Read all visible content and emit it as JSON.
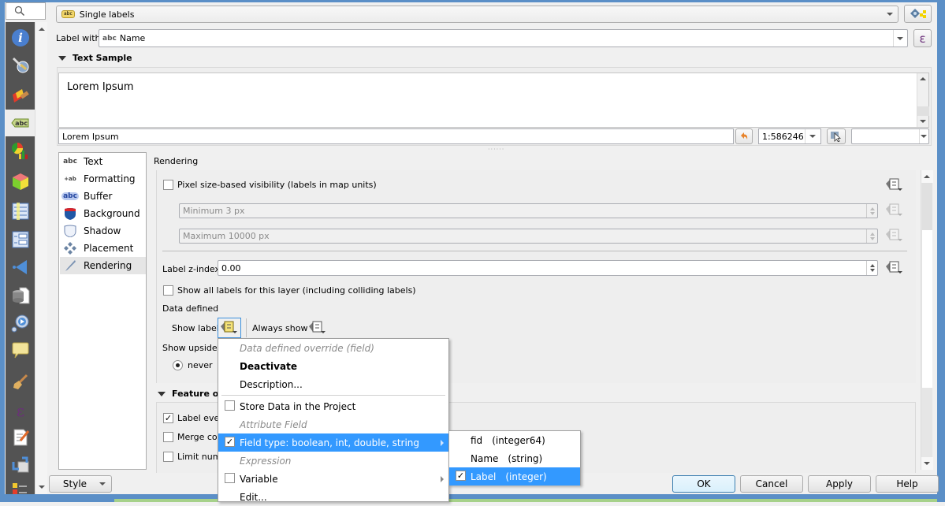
{
  "left_strip": {
    "search_icon": "magnifier",
    "icons": [
      {
        "name": "information-icon"
      },
      {
        "name": "source-settings-icon"
      },
      {
        "name": "symbology-icon"
      },
      {
        "name": "labels-icon",
        "glyph": "abc",
        "active": true
      },
      {
        "name": "diagrams-icon"
      },
      {
        "name": "3d-view-icon"
      },
      {
        "name": "fields-icon"
      },
      {
        "name": "attributes-form-icon"
      },
      {
        "name": "joins-icon"
      },
      {
        "name": "auxiliary-storage-icon"
      },
      {
        "name": "actions-icon"
      },
      {
        "name": "display-icon"
      },
      {
        "name": "rendering-icon"
      },
      {
        "name": "variables-icon",
        "glyph": "ε"
      },
      {
        "name": "metadata-icon"
      },
      {
        "name": "dependencies-icon"
      },
      {
        "name": "legend-icon"
      }
    ]
  },
  "header": {
    "mode_combo": {
      "glyph": "abc",
      "value": "Single labels"
    },
    "label_with": {
      "label": "Label with",
      "field_glyph": "abc",
      "value": "Name"
    },
    "expression_glyph": "ε"
  },
  "text_sample": {
    "title": "Text Sample",
    "preview_text": "Lorem Ipsum",
    "input_value": "Lorem Ipsum",
    "scale_value": "1:586246",
    "right_field_value": ""
  },
  "tabs": [
    {
      "glyph": "abc",
      "label": "Text"
    },
    {
      "glyph": "+ab",
      "label": "Formatting"
    },
    {
      "glyph": "abc",
      "label": "Buffer"
    },
    {
      "glyph": "",
      "label": "Background"
    },
    {
      "glyph": "",
      "label": "Shadow"
    },
    {
      "glyph": "",
      "label": "Placement"
    },
    {
      "glyph": "",
      "label": "Rendering",
      "active": true
    }
  ],
  "rendering": {
    "title": "Rendering",
    "pixel_visibility": {
      "label": "Pixel size-based visibility (labels in map units)",
      "checked": false
    },
    "min_px": "Minimum 3 px",
    "max_px": "Maximum 10000 px",
    "z_index": {
      "label": "Label z-index",
      "value": "0.00"
    },
    "show_all": {
      "label": "Show all labels for this layer (including colliding labels)",
      "checked": false
    },
    "data_defined": {
      "label": "Data defined",
      "show_label": "Show label",
      "always_show": "Always show"
    },
    "show_upside_down": {
      "label": "Show upside-d",
      "option": "never",
      "selected": true
    },
    "feature_options": {
      "title": "Feature op",
      "label_every": {
        "label": "Label ever",
        "checked": true
      },
      "merge": {
        "label": "Merge con",
        "checked": false
      },
      "limit": {
        "label": "Limit numb",
        "checked": false
      }
    }
  },
  "context_menu": {
    "items": [
      {
        "label": "Data defined override (field)",
        "type": "header"
      },
      {
        "label": "Deactivate",
        "type": "bold"
      },
      {
        "label": "Description...",
        "type": "normal"
      },
      {
        "type": "separator"
      },
      {
        "label": "Store Data in the Project",
        "type": "check",
        "checked": false
      },
      {
        "label": "Attribute Field",
        "type": "header"
      },
      {
        "label": "Field type: boolean, int, double, string",
        "type": "check",
        "checked": true,
        "submenu": true,
        "highlighted": true
      },
      {
        "label": "Expression",
        "type": "header"
      },
      {
        "label": "Variable",
        "type": "check",
        "checked": false,
        "submenu": true
      },
      {
        "label": "Edit...",
        "type": "normal"
      }
    ],
    "submenu": [
      {
        "name": "fid",
        "type": "(integer64)",
        "checked": false
      },
      {
        "name": "Name",
        "type": "(string)",
        "checked": false
      },
      {
        "name": "Label",
        "type": "(integer)",
        "checked": true,
        "highlighted": true
      }
    ]
  },
  "footer": {
    "style_button": "Style",
    "ok": "OK",
    "cancel": "Cancel",
    "apply": "Apply",
    "help": "Help"
  },
  "colors": {
    "frame": "#5b8fc7",
    "menu_highlight": "#3399ff",
    "strip_bg": "#535353",
    "dd_active": "#f5e37a"
  }
}
